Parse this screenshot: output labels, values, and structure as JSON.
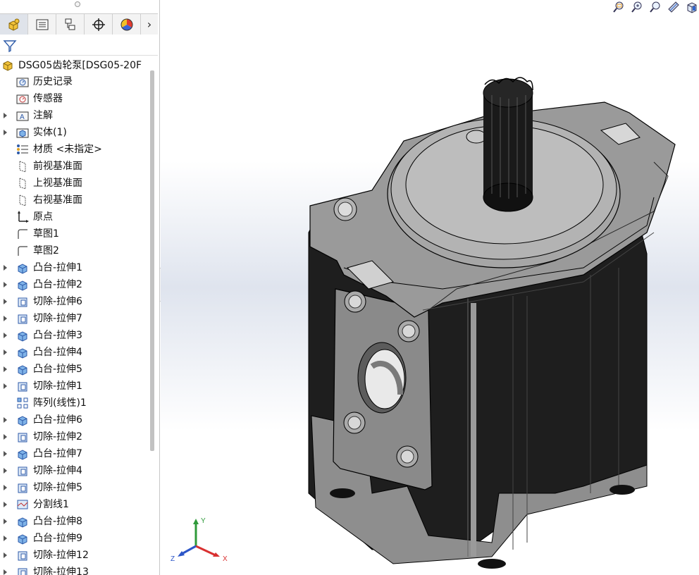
{
  "tree": {
    "root_label": "DSG05齿轮泵[DSG05-20F",
    "items": [
      {
        "label": "历史记录",
        "icon": "history-folder-icon",
        "expand": false
      },
      {
        "label": "传感器",
        "icon": "sensor-folder-icon",
        "expand": false
      },
      {
        "label": "注解",
        "icon": "annotations-folder-icon",
        "expand": true
      },
      {
        "label": "实体(1)",
        "icon": "solid-bodies-folder-icon",
        "expand": true
      },
      {
        "label": "材质 <未指定>",
        "icon": "material-icon",
        "expand": false
      },
      {
        "label": "前视基准面",
        "icon": "plane-icon",
        "expand": false
      },
      {
        "label": "上视基准面",
        "icon": "plane-icon",
        "expand": false
      },
      {
        "label": "右视基准面",
        "icon": "plane-icon",
        "expand": false
      },
      {
        "label": "原点",
        "icon": "origin-icon",
        "expand": false
      },
      {
        "label": "草图1",
        "icon": "sketch-icon",
        "expand": false
      },
      {
        "label": "草图2",
        "icon": "sketch-icon",
        "expand": false
      },
      {
        "label": "凸台-拉伸1",
        "icon": "boss-extrude-icon",
        "expand": true
      },
      {
        "label": "凸台-拉伸2",
        "icon": "boss-extrude-icon",
        "expand": true
      },
      {
        "label": "切除-拉伸6",
        "icon": "cut-extrude-icon",
        "expand": true
      },
      {
        "label": "切除-拉伸7",
        "icon": "cut-extrude-icon",
        "expand": true
      },
      {
        "label": "凸台-拉伸3",
        "icon": "boss-extrude-icon",
        "expand": true
      },
      {
        "label": "凸台-拉伸4",
        "icon": "boss-extrude-icon",
        "expand": true
      },
      {
        "label": "凸台-拉伸5",
        "icon": "boss-extrude-icon",
        "expand": true
      },
      {
        "label": "切除-拉伸1",
        "icon": "cut-extrude-icon",
        "expand": true
      },
      {
        "label": "阵列(线性)1",
        "icon": "linear-pattern-icon",
        "expand": false
      },
      {
        "label": "凸台-拉伸6",
        "icon": "boss-extrude-icon",
        "expand": true
      },
      {
        "label": "切除-拉伸2",
        "icon": "cut-extrude-icon",
        "expand": true
      },
      {
        "label": "凸台-拉伸7",
        "icon": "boss-extrude-icon",
        "expand": true
      },
      {
        "label": "切除-拉伸4",
        "icon": "cut-extrude-icon",
        "expand": true
      },
      {
        "label": "切除-拉伸5",
        "icon": "cut-extrude-icon",
        "expand": true
      },
      {
        "label": "分割线1",
        "icon": "split-line-icon",
        "expand": true
      },
      {
        "label": "凸台-拉伸8",
        "icon": "boss-extrude-icon",
        "expand": true
      },
      {
        "label": "凸台-拉伸9",
        "icon": "boss-extrude-icon",
        "expand": true
      },
      {
        "label": "切除-拉伸12",
        "icon": "cut-extrude-icon",
        "expand": true
      },
      {
        "label": "切除-拉伸13",
        "icon": "cut-extrude-icon",
        "expand": true
      }
    ]
  },
  "tabs": [
    {
      "icon": "feature-manager-icon",
      "active": true
    },
    {
      "icon": "property-manager-icon",
      "active": false
    },
    {
      "icon": "configuration-manager-icon",
      "active": false
    },
    {
      "icon": "dimxpert-icon",
      "active": false
    },
    {
      "icon": "display-manager-icon",
      "active": false
    }
  ],
  "triad": {
    "x_label": "X",
    "y_label": "Y",
    "z_label": "Z"
  },
  "colors": {
    "x_axis": "#d93030",
    "y_axis": "#2f9a3a",
    "z_axis": "#2c56c8",
    "model_body": "#8f8f8f",
    "model_dark": "#222222"
  }
}
